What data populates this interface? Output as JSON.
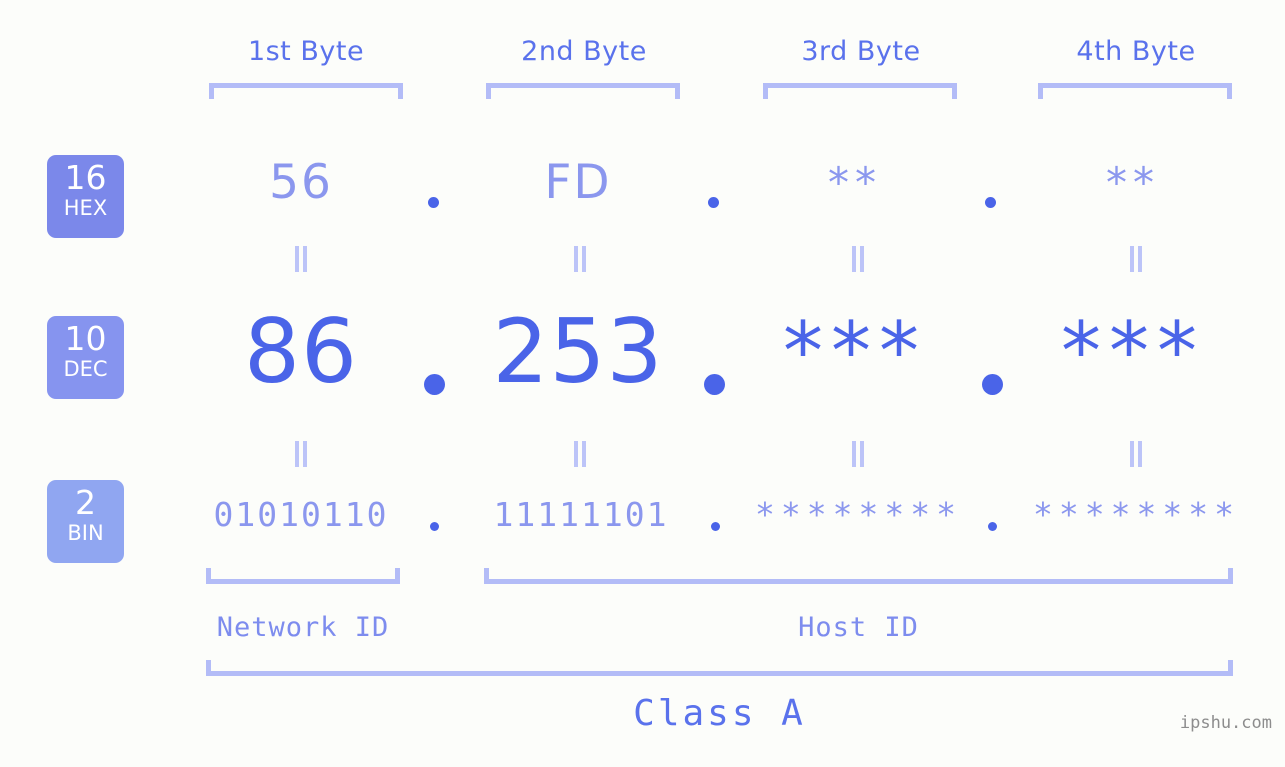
{
  "headers": [
    {
      "label": "1st Byte"
    },
    {
      "label": "2nd Byte"
    },
    {
      "label": "3rd Byte"
    },
    {
      "label": "4th Byte"
    }
  ],
  "bases": [
    {
      "number": "16",
      "name": "HEX",
      "color": "#7b88ea"
    },
    {
      "number": "10",
      "name": "DEC",
      "color": "#8694ef"
    },
    {
      "number": "2",
      "name": "BIN",
      "color": "#90a6f1"
    }
  ],
  "rows": {
    "hex": {
      "base": "16",
      "name": "HEX",
      "values": [
        "56",
        "FD",
        "**",
        "**"
      ]
    },
    "dec": {
      "base": "10",
      "name": "DEC",
      "values": [
        "86",
        "253",
        "***",
        "***"
      ]
    },
    "bin": {
      "base": "2",
      "name": "BIN",
      "values": [
        "01010110",
        "11111101",
        "********",
        "********"
      ]
    }
  },
  "separators": {
    "dot": ".",
    "equality": "||"
  },
  "segments": {
    "network_id": "Network ID",
    "host_id": "Host ID"
  },
  "class": {
    "label": "Class A"
  },
  "watermark": {
    "text": "ipshu.com"
  },
  "colors": {
    "background": "#fcfdfa",
    "accent_strong": "#4a64e8",
    "accent_mid": "#5a72ec",
    "accent_light": "#8b97ee",
    "bracket": "#b3bcf7"
  }
}
